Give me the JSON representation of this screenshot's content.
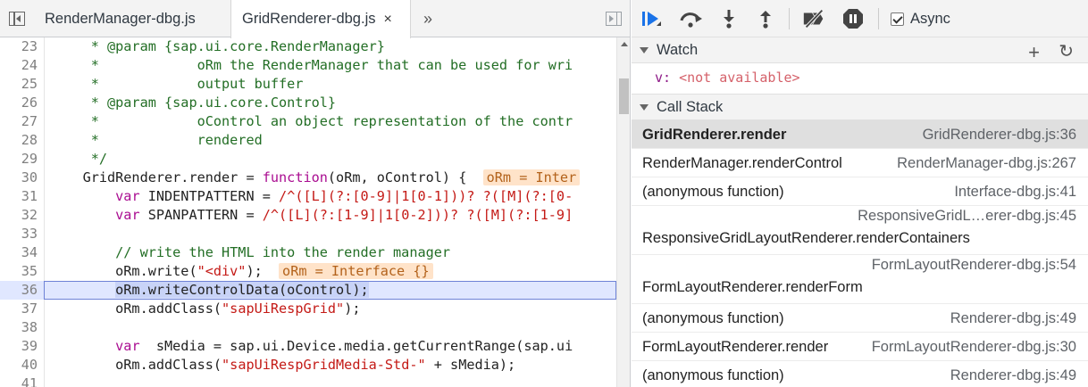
{
  "editor": {
    "tabs": [
      {
        "label": "RenderManager-dbg.js",
        "active": false
      },
      {
        "label": "GridRenderer-dbg.js",
        "active": true
      }
    ],
    "close_glyph": "×",
    "more_tabs_glyph": "»",
    "lines": [
      {
        "n": "23",
        "text": "     * @param {sap.ui.core.RenderManager}"
      },
      {
        "n": "24",
        "text": "     *            oRm the RenderManager that can be used for wri"
      },
      {
        "n": "25",
        "text": "     *            output buffer"
      },
      {
        "n": "26",
        "text": "     * @param {sap.ui.core.Control}"
      },
      {
        "n": "27",
        "text": "     *            oControl an object representation of the contr"
      },
      {
        "n": "28",
        "text": "     *            rendered"
      },
      {
        "n": "29",
        "text": "     */"
      },
      {
        "n": "30",
        "text_a": "    GridRenderer.render = ",
        "kw": "function",
        "text_b": "(oRm, oControl) {  ",
        "inline": "oRm = Inter"
      },
      {
        "n": "31",
        "text_a": "        ",
        "kw": "var",
        "text_b": " INDENTPATTERN = ",
        "str": "/^([L](?:[0-9]|1[0-1]))? ?([M](?:[0-"
      },
      {
        "n": "32",
        "text_a": "        ",
        "kw": "var",
        "text_b": " SPANPATTERN = ",
        "str": "/^([L](?:[1-9]|1[0-2]))? ?([M](?:[1-9]"
      },
      {
        "n": "33",
        "text": ""
      },
      {
        "n": "34",
        "text": "        // write the HTML into the render manager"
      },
      {
        "n": "35",
        "text_a": "        oRm.write(",
        "str": "\"<div\"",
        "text_b": ");  ",
        "inline": "oRm = Interface {}"
      },
      {
        "n": "36",
        "text": "oRm.writeControlData(oControl);"
      },
      {
        "n": "37",
        "text_a": "        oRm.addClass(",
        "str": "\"sapUiRespGrid\"",
        "text_b": ");"
      },
      {
        "n": "38",
        "text": ""
      },
      {
        "n": "39",
        "text_a": "        ",
        "kw": "var",
        "text_b": "  sMedia = sap.ui.Device.media.getCurrentRange(sap.ui"
      },
      {
        "n": "40",
        "text_a": "        oRm.addClass(",
        "str": "\"sapUiRespGridMedia-Std-\"",
        "text_b": " + sMedia);"
      },
      {
        "n": "41",
        "text": ""
      }
    ]
  },
  "debugger": {
    "async_label": "Async",
    "watch": {
      "title": "Watch",
      "expr_name": "v",
      "expr_value": "<not available>"
    },
    "call_stack": {
      "title": "Call Stack",
      "frames": [
        {
          "fn": "GridRenderer.render",
          "loc": "GridRenderer-dbg.js:36",
          "selected": true,
          "double": false
        },
        {
          "fn": "RenderManager.renderControl",
          "loc": "RenderManager-dbg.js:267",
          "selected": false,
          "double": false
        },
        {
          "fn": "(anonymous function)",
          "loc": "Interface-dbg.js:41",
          "selected": false,
          "double": false
        },
        {
          "fn": "ResponsiveGridLayoutRenderer.renderContainers",
          "loc": "ResponsiveGridL…erer-dbg.js:45",
          "selected": false,
          "double": true
        },
        {
          "fn": "FormLayoutRenderer.renderForm",
          "loc": "FormLayoutRenderer-dbg.js:54",
          "selected": false,
          "double": true
        },
        {
          "fn": "(anonymous function)",
          "loc": "Renderer-dbg.js:49",
          "selected": false,
          "double": false
        },
        {
          "fn": "FormLayoutRenderer.render",
          "loc": "FormLayoutRenderer-dbg.js:30",
          "selected": false,
          "double": false
        },
        {
          "fn": "(anonymous function)",
          "loc": "Renderer-dbg.js:49",
          "selected": false,
          "double": false
        }
      ]
    }
  }
}
